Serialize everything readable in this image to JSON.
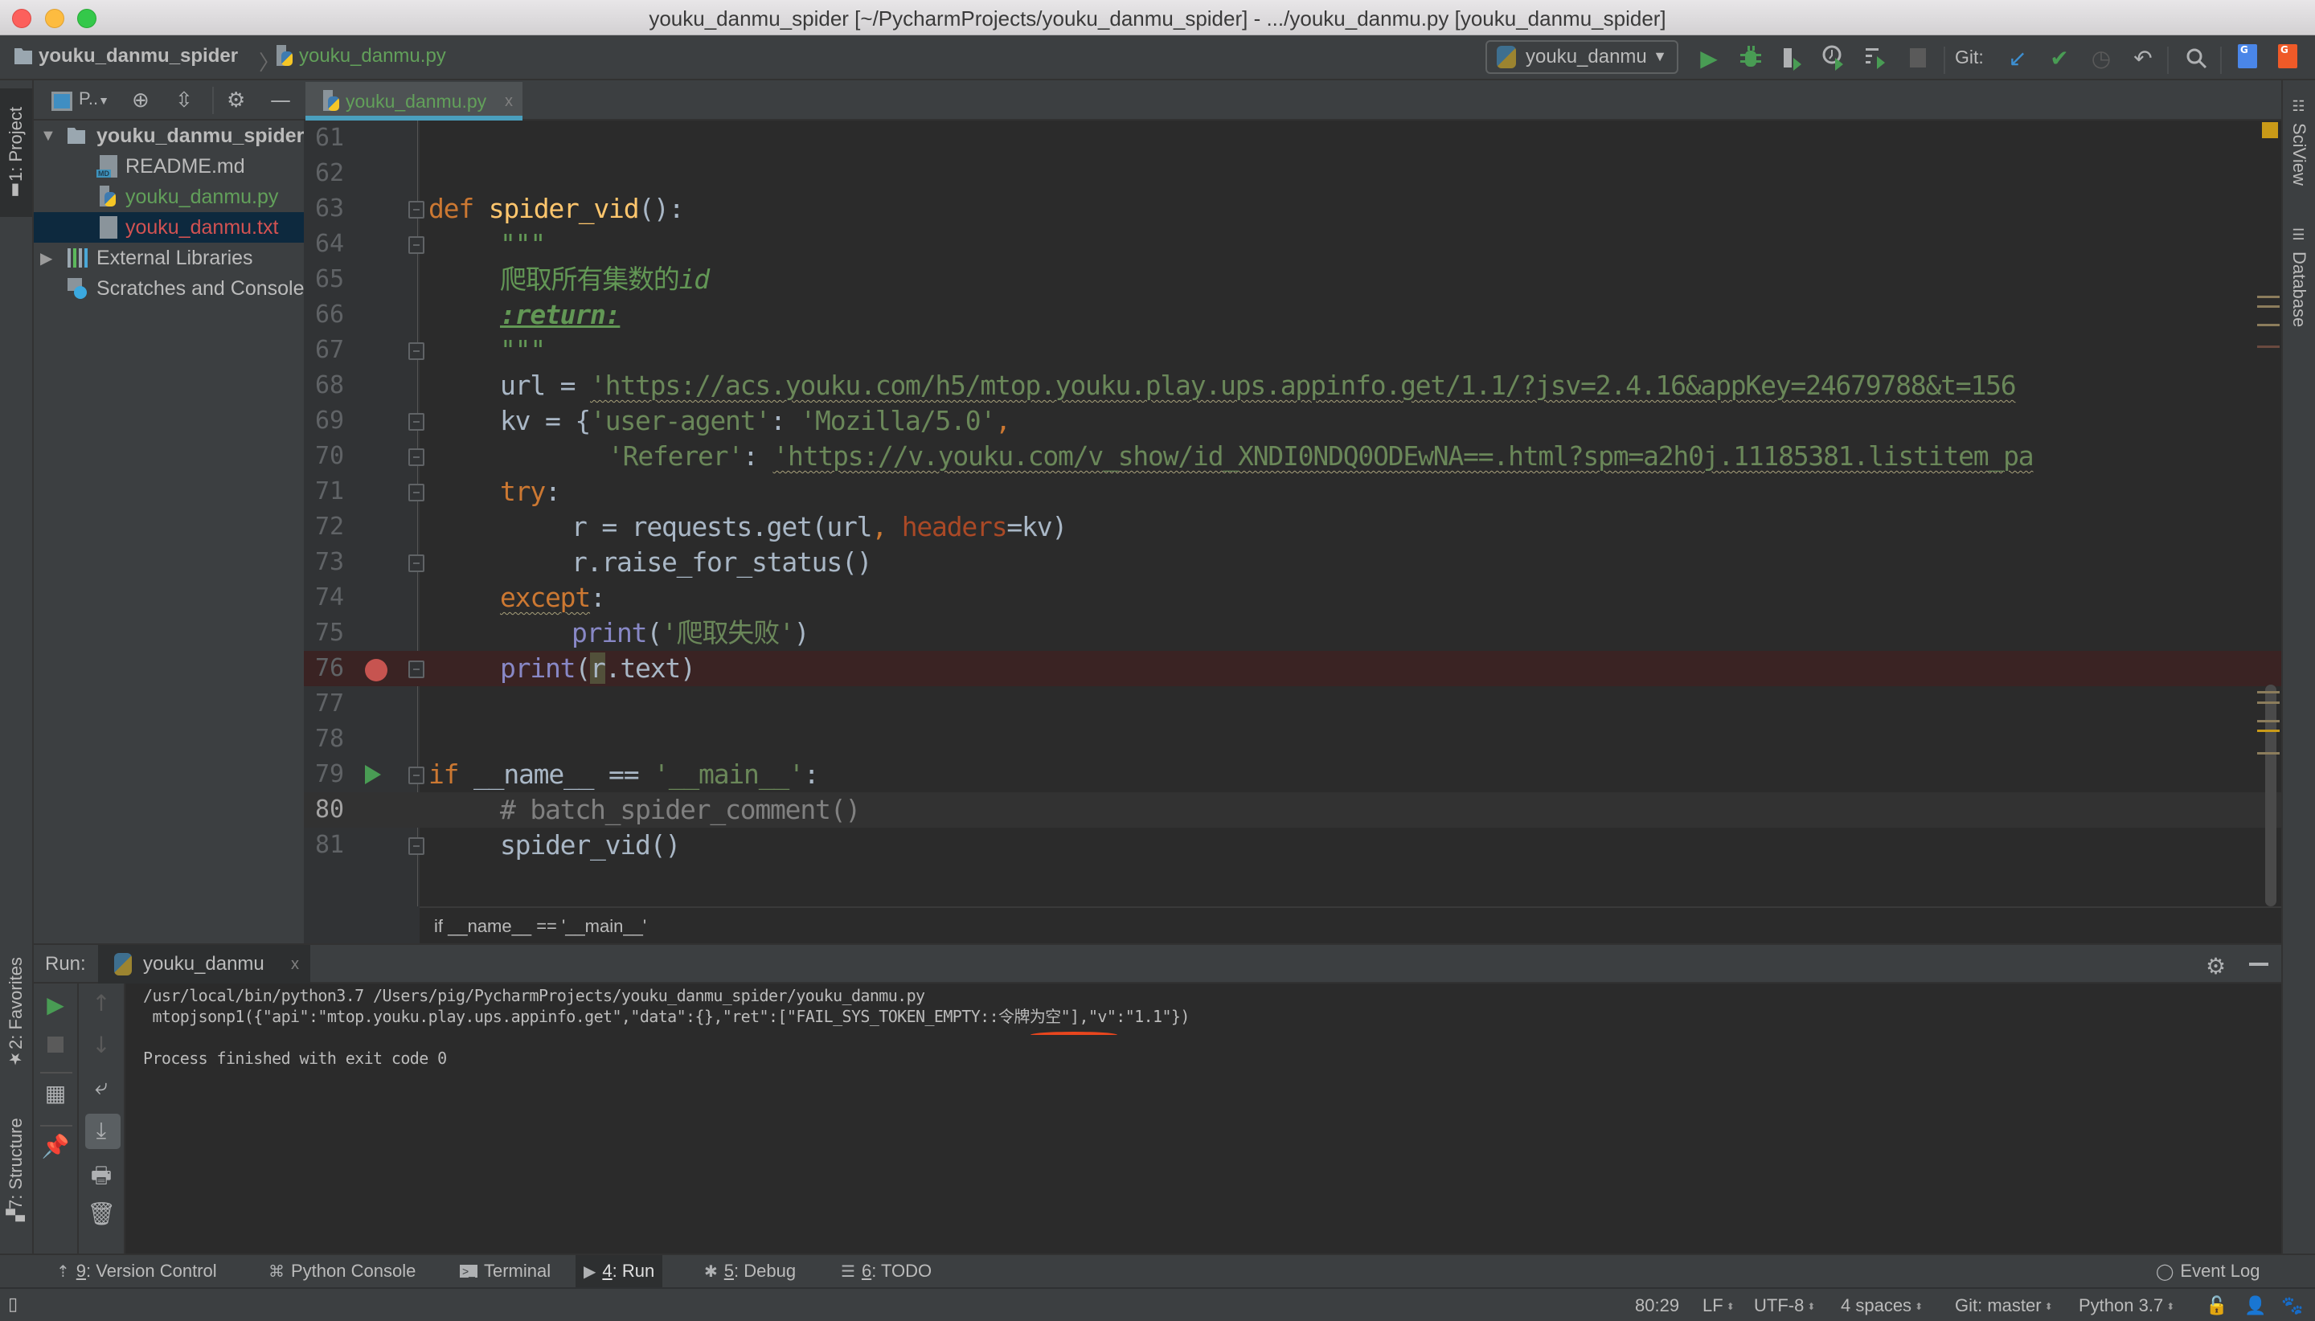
{
  "window": {
    "title": "youku_danmu_spider [~/PycharmProjects/youku_danmu_spider] - .../youku_danmu.py [youku_danmu_spider]"
  },
  "navbar": {
    "project": "youku_danmu_spider",
    "file": "youku_danmu.py",
    "run_config": "youku_danmu",
    "git_label": "Git:",
    "icons": [
      "run-icon",
      "debug-icon",
      "coverage-icon",
      "profile-icon",
      "concurrency-icon",
      "stop-icon",
      "git-update-icon",
      "git-commit-icon",
      "git-history-icon",
      "git-revert-icon",
      "search-icon",
      "translate-icon",
      "translate-alt-icon"
    ]
  },
  "left_strip": {
    "project_tab": "1: Project",
    "favorites_tab": "2: Favorites",
    "structure_tab": "7: Structure"
  },
  "project_panel": {
    "view_label": "P..",
    "tree": [
      {
        "label": "youku_danmu_spider",
        "type": "folder",
        "expanded": true,
        "color": "#bbbbbb"
      },
      {
        "label": "README.md",
        "type": "md",
        "color": "#bbbbbb"
      },
      {
        "label": "youku_danmu.py",
        "type": "py",
        "color": "#62a05a"
      },
      {
        "label": "youku_danmu.txt",
        "type": "txt",
        "color": "#d25252",
        "selected": true
      },
      {
        "label": "External Libraries",
        "type": "library",
        "expanded": false,
        "color": "#bbbbbb"
      },
      {
        "label": "Scratches and Consoles",
        "type": "scratch",
        "color": "#bbbbbb"
      }
    ]
  },
  "editor": {
    "tab_label": "youku_danmu.py",
    "close_glyph": "x",
    "lines": [
      {
        "num": "61"
      },
      {
        "num": "62"
      },
      {
        "num": "63",
        "def_kw": "def",
        "fn_name": "spider_vid",
        "rest": "():"
      },
      {
        "num": "64",
        "text": "\"\"\""
      },
      {
        "num": "65",
        "text_cn": "爬取所有集数的",
        "text_it": "id"
      },
      {
        "num": "66",
        "text": ":return:"
      },
      {
        "num": "67",
        "text": "\"\"\""
      },
      {
        "num": "68",
        "var": "url = ",
        "str": "'https://acs.youku.com/h5/mtop.youku.play.ups.appinfo.get/1.1/?jsv=2.4.16&appKey=24679788&t=156"
      },
      {
        "num": "69",
        "var": "kv = {",
        "key": "'user-agent'",
        "colon": ": ",
        "val": "'Mozilla/5.0'",
        "comma": ","
      },
      {
        "num": "70",
        "key": "'Referer'",
        "colon": ": ",
        "str": "'https://v.youku.com/v_show/id_XNDI0NDQ0ODEwNA==.html?spm=a2h0j.11185381.listitem_pa"
      },
      {
        "num": "71",
        "kw": "try",
        "rest": ":"
      },
      {
        "num": "72",
        "pre": "r = requests.get(url",
        "comma": ", ",
        "param": "headers",
        "post": "=kv)"
      },
      {
        "num": "73",
        "text": "r.raise_for_status()"
      },
      {
        "num": "74",
        "kw": "except",
        "rest": ":"
      },
      {
        "num": "75",
        "builtin": "print",
        "open": "(",
        "str": "'爬取失败'",
        "close": ")"
      },
      {
        "num": "76",
        "builtin": "print",
        "open": "(",
        "hl": "r",
        "rest": ".text)",
        "breakpoint": true
      },
      {
        "num": "77"
      },
      {
        "num": "78"
      },
      {
        "num": "79",
        "kw": "if",
        "mid": " __name__ == ",
        "str": "'__main__'",
        "rest": ":",
        "runnable": true
      },
      {
        "num": "80",
        "comment": "# batch_spider_comment()",
        "current": true
      },
      {
        "num": "81",
        "text": "spider_vid()"
      }
    ],
    "breadcrumb": "if __name__ == '__main__'",
    "cursor": "80:29"
  },
  "right_strip": {
    "sciview": "SciView",
    "database": "Database"
  },
  "run_panel": {
    "label": "Run:",
    "tab": "youku_danmu",
    "console": [
      "/usr/local/bin/python3.7 /Users/pig/PycharmProjects/youku_danmu_spider/youku_danmu.py",
      " mtopjsonp1({\"api\":\"mtop.youku.play.ups.appinfo.get\",\"data\":{},\"ret\":[\"FAIL_SYS_TOKEN_EMPTY::令牌为空\"],\"v\":\"1.1\"})",
      "",
      "Process finished with exit code 0"
    ],
    "annotation": "red underline under 令牌为空"
  },
  "tool_windows": [
    {
      "num": "9",
      "label": ": Version Control",
      "icon": "version-control-icon"
    },
    {
      "num": "",
      "label": "Python Console",
      "icon": "python-console-icon"
    },
    {
      "num": "",
      "label": "Terminal",
      "icon": "terminal-icon"
    },
    {
      "num": "4",
      "label": ": Run",
      "icon": "run-icon",
      "active": true
    },
    {
      "num": "5",
      "label": ": Debug",
      "icon": "debug-icon"
    },
    {
      "num": "6",
      "label": ": TODO",
      "icon": "todo-icon"
    }
  ],
  "event_log": "Event Log",
  "status_bar": {
    "position": "80:29",
    "line_sep": "LF",
    "encoding": "UTF-8",
    "indent": "4 spaces",
    "vcs": "Git: master",
    "interpreter": "Python 3.7"
  },
  "colors": {
    "accent_tab": "#4a9fbe",
    "breakpoint": "#c75450",
    "run_green": "#499c54",
    "annotation_red": "#e8461e"
  }
}
